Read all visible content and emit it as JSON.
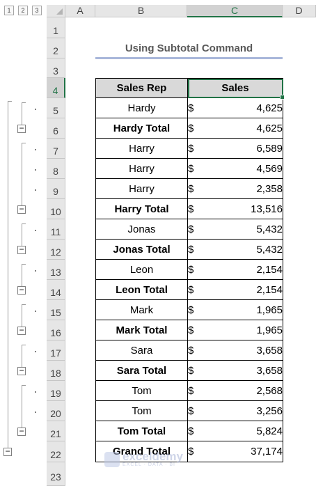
{
  "outline": {
    "levels": [
      "1",
      "2",
      "3"
    ]
  },
  "columns": [
    "A",
    "B",
    "C",
    "D"
  ],
  "rows": [
    "1",
    "2",
    "3",
    "4",
    "5",
    "6",
    "7",
    "8",
    "9",
    "10",
    "11",
    "12",
    "13",
    "14",
    "15",
    "16",
    "17",
    "18",
    "19",
    "20",
    "21",
    "22",
    "23"
  ],
  "title": "Using Subtotal Command",
  "table": {
    "headers": [
      "Sales Rep",
      "Sales"
    ],
    "currency": "$",
    "rows": [
      {
        "rep": "Hardy",
        "sales": "4,625",
        "total": false
      },
      {
        "rep": "Hardy Total",
        "sales": "4,625",
        "total": true
      },
      {
        "rep": "Harry",
        "sales": "6,589",
        "total": false
      },
      {
        "rep": "Harry",
        "sales": "4,569",
        "total": false
      },
      {
        "rep": "Harry",
        "sales": "2,358",
        "total": false
      },
      {
        "rep": "Harry Total",
        "sales": "13,516",
        "total": true
      },
      {
        "rep": "Jonas",
        "sales": "5,432",
        "total": false
      },
      {
        "rep": "Jonas Total",
        "sales": "5,432",
        "total": true
      },
      {
        "rep": "Leon",
        "sales": "2,154",
        "total": false
      },
      {
        "rep": "Leon Total",
        "sales": "2,154",
        "total": true
      },
      {
        "rep": "Mark",
        "sales": "1,965",
        "total": false
      },
      {
        "rep": "Mark Total",
        "sales": "1,965",
        "total": true
      },
      {
        "rep": "Sara",
        "sales": "3,658",
        "total": false
      },
      {
        "rep": "Sara Total",
        "sales": "3,658",
        "total": true
      },
      {
        "rep": "Tom",
        "sales": "2,568",
        "total": false
      },
      {
        "rep": "Tom",
        "sales": "3,256",
        "total": false
      },
      {
        "rep": "Tom Total",
        "sales": "5,824",
        "total": true
      },
      {
        "rep": "Grand Total",
        "sales": "37,174",
        "total": true
      }
    ]
  },
  "watermark": {
    "name": "exceldemy",
    "tagline": "EXCEL · DATA · BI"
  },
  "colors": {
    "selection": "#217346",
    "header_fill": "#d9d9d9",
    "title_underline": "#a9b7da"
  }
}
